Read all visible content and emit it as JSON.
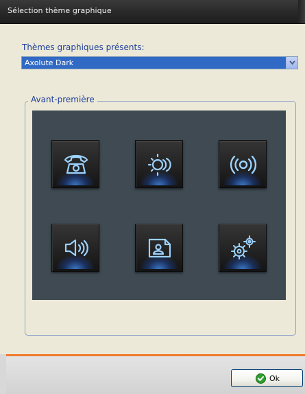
{
  "window": {
    "title": "Sélection thème graphique"
  },
  "themes": {
    "label": "Thèmes graphiques présents:",
    "selected": "Axolute Dark"
  },
  "preview": {
    "legend": "Avant-première",
    "icons": [
      {
        "name": "telephone-icon"
      },
      {
        "name": "scene-light-icon"
      },
      {
        "name": "broadcast-icon"
      },
      {
        "name": "speaker-icon"
      },
      {
        "name": "contact-card-icon"
      },
      {
        "name": "settings-gears-icon"
      }
    ]
  },
  "footer": {
    "ok_label": "Ok"
  },
  "colors": {
    "accent_orange": "#f07a2a",
    "selection_blue": "#316ac5",
    "label_blue": "#1f3f9a",
    "icon_glow": "#4a9cff"
  }
}
